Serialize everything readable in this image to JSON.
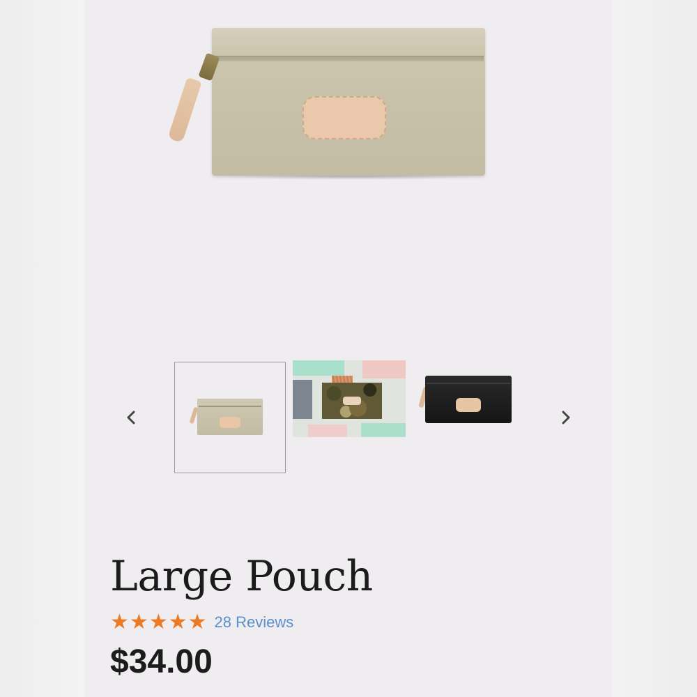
{
  "product": {
    "title": "Large Pouch",
    "rating_stars": 5,
    "reviews_label": "28 Reviews",
    "price": "$34.00"
  },
  "gallery": {
    "main_image": "tan-pouch-photo",
    "thumbnails": [
      {
        "name": "tan-pouch-thumbnail",
        "selected": true
      },
      {
        "name": "camo-pouch-lifestyle-thumbnail",
        "selected": false
      },
      {
        "name": "black-pouch-thumbnail",
        "selected": false
      }
    ],
    "prev_icon": "chevron-left-icon",
    "next_icon": "chevron-right-icon"
  },
  "colors": {
    "star": "#ec7a24",
    "link": "#5b8fcd",
    "text": "#1b1b1b"
  }
}
